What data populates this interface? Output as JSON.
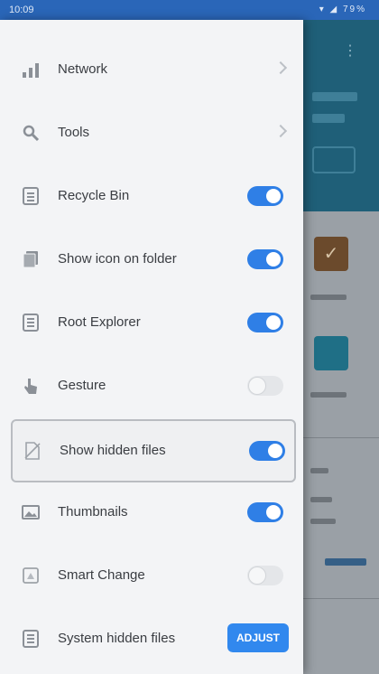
{
  "status_bar": {
    "time": "10:09",
    "icons": "▾ ◢ 79%"
  },
  "drawer": {
    "items": [
      {
        "label": "Network",
        "icon": "network-icon",
        "control": "chevron"
      },
      {
        "label": "Tools",
        "icon": "tools-icon",
        "control": "chevron"
      },
      {
        "label": "Recycle Bin",
        "icon": "recycle-bin-icon",
        "control": "toggle",
        "on": true
      },
      {
        "label": "Show icon on folder",
        "icon": "folder-icon",
        "control": "toggle",
        "on": true
      },
      {
        "label": "Root Explorer",
        "icon": "root-explorer-icon",
        "control": "toggle",
        "on": true
      },
      {
        "label": "Gesture",
        "icon": "gesture-icon",
        "control": "toggle",
        "on": false
      },
      {
        "label": "Show hidden files",
        "icon": "hidden-files-icon",
        "control": "toggle",
        "on": true,
        "highlighted": true
      },
      {
        "label": "Thumbnails",
        "icon": "thumbnails-icon",
        "control": "toggle",
        "on": true
      },
      {
        "label": "Smart Change",
        "icon": "smart-change-icon",
        "control": "toggle",
        "on": false
      },
      {
        "label": "System hidden files",
        "icon": "system-files-icon",
        "control": "button",
        "button_label": "ADJUST"
      }
    ]
  },
  "colors": {
    "accent": "#2f7fe6",
    "status_bar": "#2a66b8",
    "drawer_bg": "#f3f4f6",
    "header_teal": "#1f5f78"
  }
}
